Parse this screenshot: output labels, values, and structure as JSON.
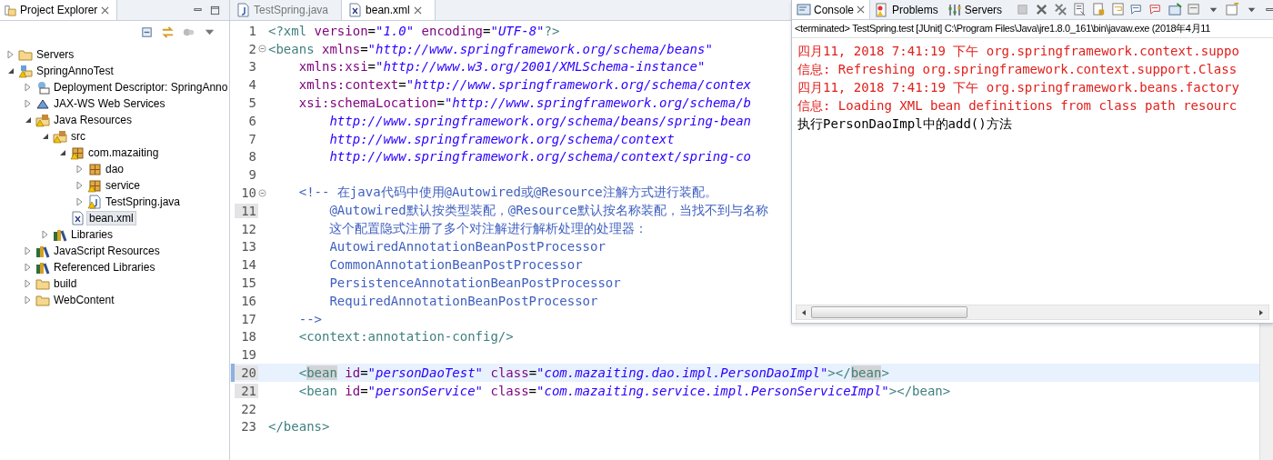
{
  "explorer": {
    "tab": {
      "label": "Project Explorer",
      "selected": true
    },
    "tree": [
      {
        "label": "Servers",
        "kind": "folder",
        "expanded": false,
        "warning": false,
        "selected": false
      },
      {
        "label": "SpringAnnoTest",
        "kind": "project",
        "expanded": true,
        "warning": true,
        "selected": false,
        "children": [
          {
            "label": "Deployment Descriptor: SpringAnno",
            "kind": "descriptor",
            "expanded": false,
            "warning": false,
            "selected": false
          },
          {
            "label": "JAX-WS Web Services",
            "kind": "webservice",
            "expanded": false,
            "warning": false,
            "selected": false
          },
          {
            "label": "Java Resources",
            "kind": "javares",
            "expanded": true,
            "warning": true,
            "selected": false,
            "children": [
              {
                "label": "src",
                "kind": "srcfolder",
                "expanded": true,
                "warning": true,
                "selected": false,
                "children": [
                  {
                    "label": "com.mazaiting",
                    "kind": "package",
                    "expanded": true,
                    "warning": true,
                    "selected": false,
                    "children": [
                      {
                        "label": "dao",
                        "kind": "package",
                        "expanded": false,
                        "warning": false,
                        "selected": false
                      },
                      {
                        "label": "service",
                        "kind": "package",
                        "expanded": false,
                        "warning": true,
                        "selected": false
                      },
                      {
                        "label": "TestSpring.java",
                        "kind": "javafile",
                        "expanded": false,
                        "warning": true,
                        "selected": false
                      }
                    ]
                  },
                  {
                    "label": "bean.xml",
                    "kind": "xmlfile",
                    "warning": false,
                    "selected": true
                  }
                ]
              },
              {
                "label": "Libraries",
                "kind": "library",
                "expanded": false,
                "warning": false,
                "selected": false
              }
            ]
          },
          {
            "label": "JavaScript Resources",
            "kind": "library",
            "expanded": false,
            "warning": false,
            "selected": false
          },
          {
            "label": "Referenced Libraries",
            "kind": "library",
            "expanded": false,
            "warning": false,
            "selected": false
          },
          {
            "label": "build",
            "kind": "folder",
            "expanded": false,
            "warning": false,
            "selected": false
          },
          {
            "label": "WebContent",
            "kind": "folder",
            "expanded": false,
            "warning": false,
            "selected": false
          }
        ]
      }
    ]
  },
  "editor": {
    "tabs": [
      {
        "label": "TestSpring.java",
        "kind": "javafile",
        "selected": false
      },
      {
        "label": "bean.xml",
        "kind": "xmlfile",
        "selected": true
      }
    ],
    "lines": [
      {
        "number": "1",
        "fold": false,
        "marked": false,
        "current": false,
        "tokens": [
          {
            "kind": "tag",
            "text": "<?xml"
          },
          {
            "kind": "attr",
            "text": " version"
          },
          {
            "kind": "plain",
            "text": "="
          },
          {
            "kind": "string",
            "text": "\"1.0\""
          },
          {
            "kind": "attr",
            "text": " encoding"
          },
          {
            "kind": "plain",
            "text": "="
          },
          {
            "kind": "string",
            "text": "\"UTF-8\""
          },
          {
            "kind": "tag",
            "text": "?>"
          }
        ]
      },
      {
        "number": "2",
        "fold": true,
        "marked": false,
        "current": false,
        "tokens": [
          {
            "kind": "tag",
            "text": "<beans"
          },
          {
            "kind": "attr",
            "text": " xmlns"
          },
          {
            "kind": "plain",
            "text": "="
          },
          {
            "kind": "string",
            "text": "\"http://www.springframework.org/schema/beans\""
          }
        ]
      },
      {
        "number": "3",
        "fold": false,
        "marked": false,
        "current": false,
        "tokens": [
          {
            "kind": "attr",
            "text": "    xmlns:xsi"
          },
          {
            "kind": "plain",
            "text": "="
          },
          {
            "kind": "string",
            "text": "\"http://www.w3.org/2001/XMLSchema-instance\""
          }
        ]
      },
      {
        "number": "4",
        "fold": false,
        "marked": false,
        "current": false,
        "tokens": [
          {
            "kind": "attr",
            "text": "    xmlns:context"
          },
          {
            "kind": "plain",
            "text": "="
          },
          {
            "kind": "string",
            "text": "\"http://www.springframework.org/schema/contex"
          }
        ]
      },
      {
        "number": "5",
        "fold": false,
        "marked": false,
        "current": false,
        "tokens": [
          {
            "kind": "attr",
            "text": "    xsi:schemaLocation"
          },
          {
            "kind": "plain",
            "text": "="
          },
          {
            "kind": "string",
            "text": "\"http://www.springframework.org/schema/b"
          }
        ]
      },
      {
        "number": "6",
        "fold": false,
        "marked": false,
        "current": false,
        "tokens": [
          {
            "kind": "string",
            "text": "        http://www.springframework.org/schema/beans/spring-bean"
          }
        ]
      },
      {
        "number": "7",
        "fold": false,
        "marked": false,
        "current": false,
        "tokens": [
          {
            "kind": "string",
            "text": "        http://www.springframework.org/schema/context"
          }
        ]
      },
      {
        "number": "8",
        "fold": false,
        "marked": false,
        "current": false,
        "tokens": [
          {
            "kind": "string",
            "text": "        http://www.springframework.org/schema/context/spring-co"
          }
        ]
      },
      {
        "number": "9",
        "fold": false,
        "marked": false,
        "current": false
      },
      {
        "number": "10",
        "fold": true,
        "marked": false,
        "current": false,
        "tokens": [
          {
            "kind": "comment",
            "text": "    <!-- 在java代码中使用@Autowired或@Resource注解方式进行装配。"
          }
        ]
      },
      {
        "number": "11",
        "fold": false,
        "marked": true,
        "current": false,
        "tokens": [
          {
            "kind": "comment",
            "text": "        @Autowired默认按类型装配，@Resource默认按名称装配，当找不到与名称"
          }
        ]
      },
      {
        "number": "12",
        "fold": false,
        "marked": false,
        "current": false,
        "tokens": [
          {
            "kind": "comment",
            "text": "        这个配置隐式注册了多个对注解进行解析处理的处理器："
          }
        ]
      },
      {
        "number": "13",
        "fold": false,
        "marked": false,
        "current": false,
        "tokens": [
          {
            "kind": "comment",
            "text": "        AutowiredAnnotationBeanPostProcessor"
          }
        ]
      },
      {
        "number": "14",
        "fold": false,
        "marked": false,
        "current": false,
        "tokens": [
          {
            "kind": "comment",
            "text": "        CommonAnnotationBeanPostProcessor"
          }
        ]
      },
      {
        "number": "15",
        "fold": false,
        "marked": false,
        "current": false,
        "tokens": [
          {
            "kind": "comment",
            "text": "        PersistenceAnnotationBeanPostProcessor"
          }
        ]
      },
      {
        "number": "16",
        "fold": false,
        "marked": false,
        "current": false,
        "tokens": [
          {
            "kind": "comment",
            "text": "        RequiredAnnotationBeanPostProcessor"
          }
        ]
      },
      {
        "number": "17",
        "fold": false,
        "marked": false,
        "current": false,
        "tokens": [
          {
            "kind": "comment",
            "text": "    -->"
          }
        ]
      },
      {
        "number": "18",
        "fold": false,
        "marked": false,
        "current": false,
        "tokens": [
          {
            "kind": "tag",
            "text": "    <context:annotation-config/>"
          }
        ]
      },
      {
        "number": "19",
        "fold": false,
        "marked": false,
        "current": false
      },
      {
        "number": "20",
        "fold": false,
        "marked": true,
        "current": true,
        "tokens": [
          {
            "kind": "tag",
            "text": "    <"
          },
          {
            "kind": "match",
            "text": "bean"
          },
          {
            "kind": "attr",
            "text": " id"
          },
          {
            "kind": "plain",
            "text": "="
          },
          {
            "kind": "string",
            "text": "\"personDaoTest\""
          },
          {
            "kind": "attr",
            "text": " class"
          },
          {
            "kind": "plain",
            "text": "="
          },
          {
            "kind": "string",
            "text": "\"com.mazaiting.dao.impl.PersonDaoImpl\""
          },
          {
            "kind": "tag",
            "text": "></"
          },
          {
            "kind": "match",
            "text": "bean"
          },
          {
            "kind": "tag",
            "text": ">"
          }
        ]
      },
      {
        "number": "21",
        "fold": false,
        "marked": true,
        "current": false,
        "tokens": [
          {
            "kind": "tag",
            "text": "    <bean"
          },
          {
            "kind": "attr",
            "text": " id"
          },
          {
            "kind": "plain",
            "text": "="
          },
          {
            "kind": "string",
            "text": "\"personService\""
          },
          {
            "kind": "attr",
            "text": " class"
          },
          {
            "kind": "plain",
            "text": "="
          },
          {
            "kind": "string",
            "text": "\"com.mazaiting.service.impl.PersonServiceImpl\""
          },
          {
            "kind": "tag",
            "text": "></bean>"
          }
        ]
      },
      {
        "number": "22",
        "fold": false,
        "marked": false,
        "current": false
      },
      {
        "number": "23",
        "fold": false,
        "marked": false,
        "current": false,
        "tokens": [
          {
            "kind": "tag",
            "text": "</beans>"
          }
        ]
      }
    ]
  },
  "console": {
    "tabs": [
      {
        "label": "Console",
        "kind": "console",
        "selected": true
      },
      {
        "label": "Problems",
        "kind": "problems",
        "selected": false
      },
      {
        "label": "Servers",
        "kind": "servers",
        "selected": false
      }
    ],
    "header": "<terminated> TestSpring.test [JUnit] C:\\Program Files\\Java\\jre1.8.0_161\\bin\\javaw.exe (2018年4月11",
    "output": [
      {
        "kind": "err",
        "text": "四月11, 2018 7:41:19 下午 org.springframework.context.suppo"
      },
      {
        "kind": "err",
        "text": "信息: Refreshing org.springframework.context.support.Class"
      },
      {
        "kind": "err",
        "text": "四月11, 2018 7:41:19 下午 org.springframework.beans.factory"
      },
      {
        "kind": "err",
        "text": "信息: Loading XML bean definitions from class path resourc"
      },
      {
        "kind": "out",
        "text": "执行PersonDaoImpl中的add()方法"
      }
    ]
  }
}
